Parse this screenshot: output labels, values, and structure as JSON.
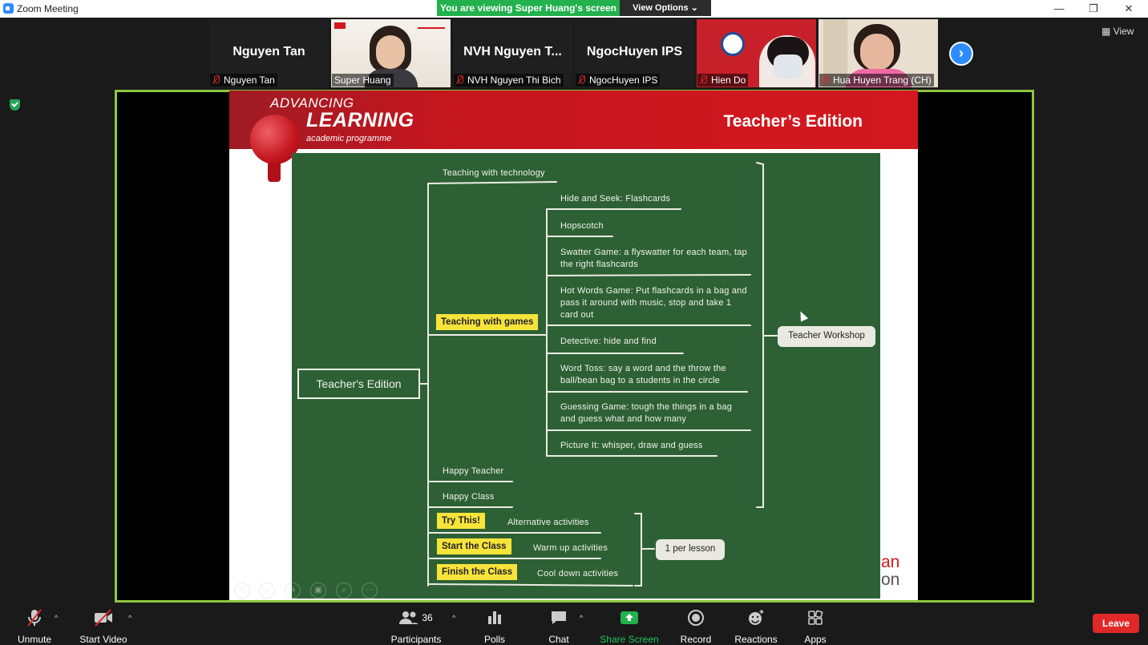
{
  "window": {
    "title": "Zoom Meeting",
    "minimize": "—",
    "restore": "❐",
    "close": "✕"
  },
  "share_banner": {
    "text": "You are viewing Super Huang's screen",
    "view_options": "View Options ⌄"
  },
  "gallery": {
    "tiles": [
      {
        "name": "Nguyen Tan",
        "display": "Nguyen Tan"
      },
      {
        "name": "Super Huang",
        "display": ""
      },
      {
        "name": "NVH Nguyen Thi Bich",
        "display": "NVH Nguyen T..."
      },
      {
        "name": "NgocHuyen IPS",
        "display": "NgocHuyen IPS"
      },
      {
        "name": "Hien Do",
        "display": ""
      },
      {
        "name": "Hua Huyen Trang (CH)",
        "display": ""
      }
    ],
    "next": "›",
    "view_label": "View"
  },
  "slide": {
    "logo_advancing": "ADVANCING",
    "logo_learning": "LEARNING",
    "logo_sub": "academic programme",
    "header_title": "Teacher’s Edition",
    "brand_tail_1": "an",
    "brand_tail_2": "on",
    "mindmap": {
      "root": "Teacher's Edition",
      "teaching_with_technology": "Teaching with technology",
      "teaching_with_games": "Teaching with games",
      "games": [
        "Hide and Seek: Flashcards",
        "Hopscotch",
        "Swatter Game: a flyswatter for each team, tap the right flashcards",
        "Hot Words Game: Put flashcards in a bag and pass it around with music, stop and take 1 card out",
        "Detective: hide and find",
        "Word Toss: say a word and the throw the ball/bean bag to a students in the circle",
        "Guessing Game: tough the things in a bag and guess what and how many",
        "Picture It: whisper, draw and guess"
      ],
      "happy_teacher": "Happy Teacher",
      "happy_class": "Happy Class",
      "try_this": "Try This!",
      "start_the_class": "Start the Class",
      "finish_the_class": "Finish the Class",
      "alternative_activities": "Alternative activities",
      "warm_up_activities": "Warm up activities",
      "cool_down_activities": "Cool down activities",
      "teacher_workshop": "Teacher Workshop",
      "per_lesson": "1 per lesson"
    }
  },
  "toolbar": {
    "unmute": "Unmute",
    "start_video": "Start Video",
    "participants": "Participants",
    "participant_count": "36",
    "polls": "Polls",
    "chat": "Chat",
    "share_screen": "Share Screen",
    "record": "Record",
    "reactions": "Reactions",
    "apps": "Apps",
    "leave": "Leave",
    "caret": "^"
  },
  "colors": {
    "share_green": "#22b14c",
    "frame_green": "#8dc63f",
    "zoom_blue": "#2d8cff",
    "leave_red": "#e02828",
    "board_green": "#2d6135",
    "header_red": "#d4181f",
    "highlight_yellow": "#f7e43a"
  }
}
